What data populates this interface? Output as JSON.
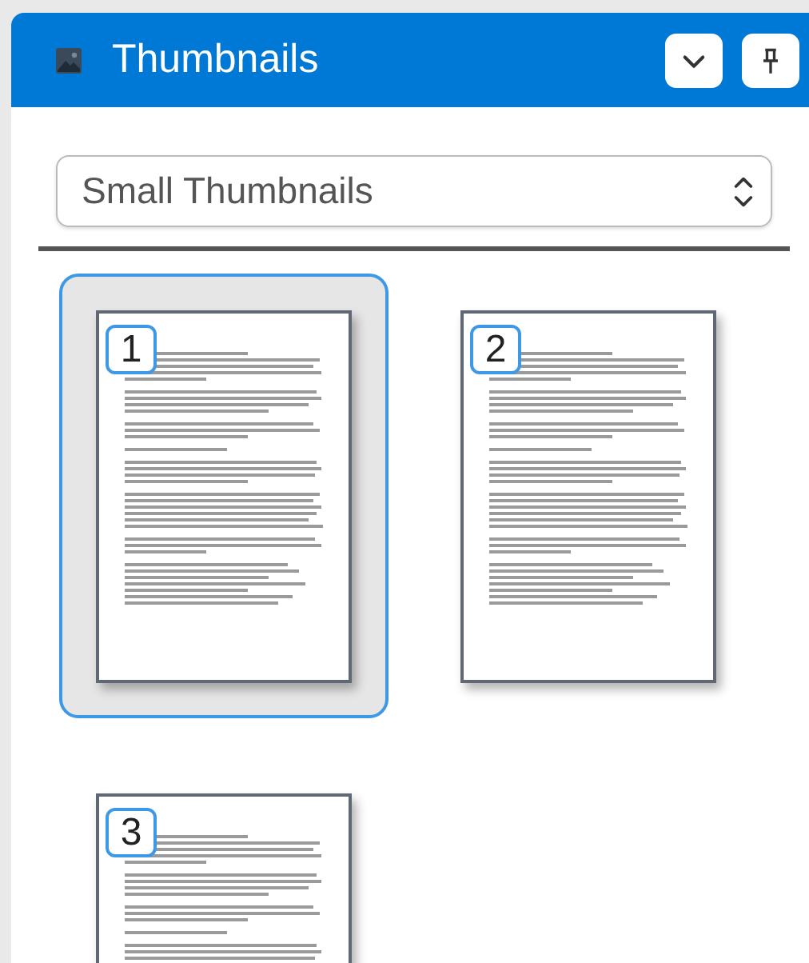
{
  "panel": {
    "title": "Thumbnails"
  },
  "view_select": {
    "value": "Small Thumbnails"
  },
  "thumbnails": [
    {
      "label": "1",
      "selected": true
    },
    {
      "label": "2",
      "selected": false
    },
    {
      "label": "3",
      "selected": false
    }
  ]
}
